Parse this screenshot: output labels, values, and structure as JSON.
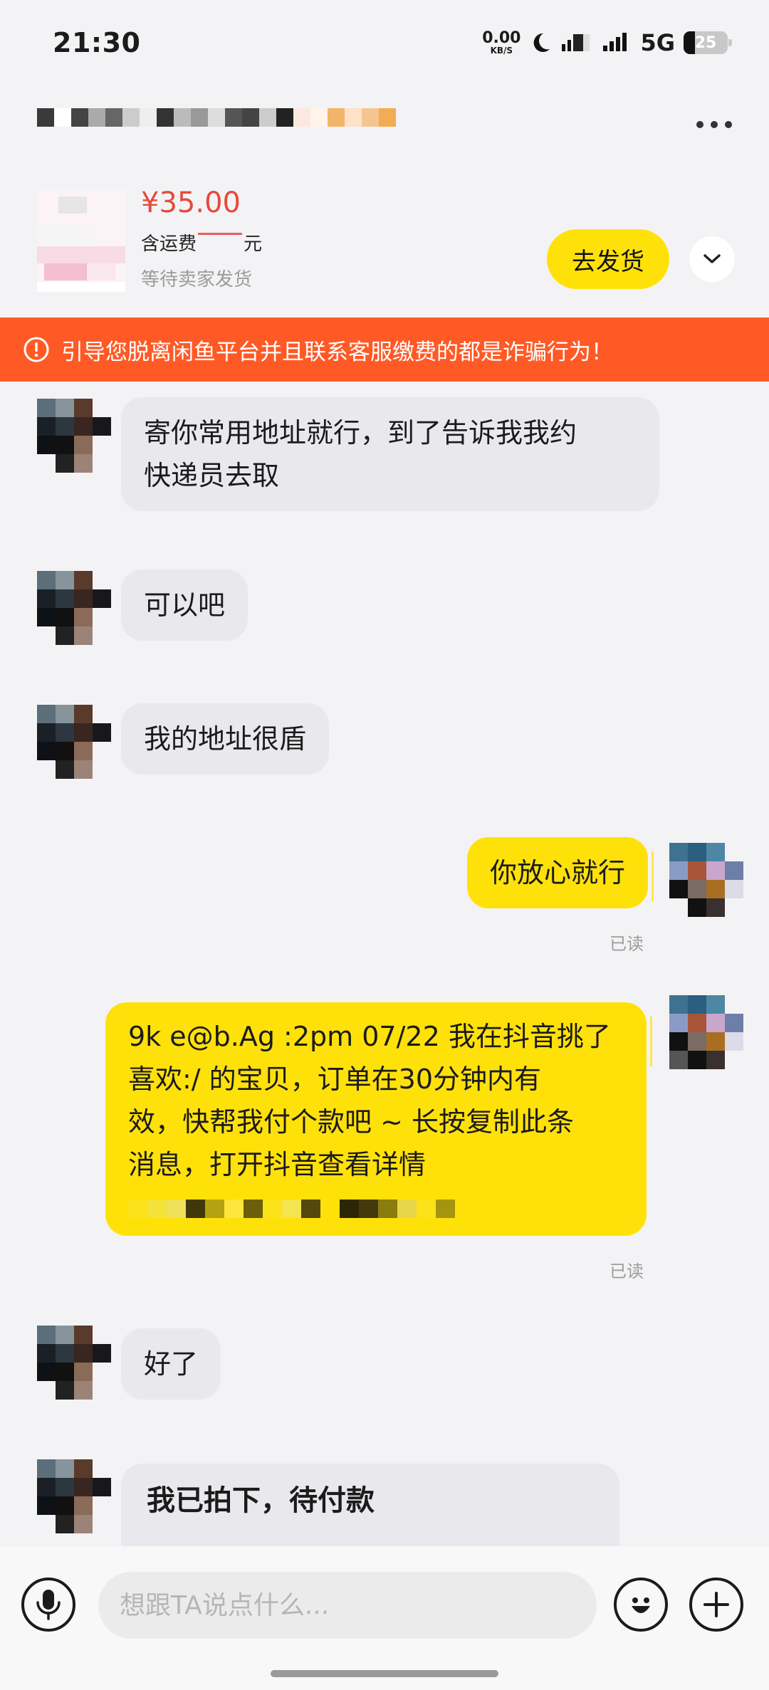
{
  "status_bar": {
    "time": "21:30",
    "net_speed_value": "0.00",
    "net_speed_unit": "KB/S",
    "network": "5G",
    "battery": "25"
  },
  "header": {
    "contact_name_hidden": true
  },
  "product": {
    "price": "¥35.00",
    "shipping_prefix": "含运费",
    "shipping_suffix": "元",
    "status": "等待卖家发货",
    "ship_button": "去发货"
  },
  "warning": {
    "text": "引导您脱离闲鱼平台并且联系客服缴费的都是诈骗行为！"
  },
  "messages": [
    {
      "side": "in",
      "text_lines": [
        "寄你常用地址就行，到了告诉我我约",
        "快递员去取"
      ]
    },
    {
      "side": "in",
      "text_lines": [
        "可以吧"
      ]
    },
    {
      "side": "in",
      "text_lines": [
        "我的地址很盾"
      ]
    },
    {
      "side": "out",
      "text_lines": [
        "你放心就行"
      ],
      "status": "已读"
    },
    {
      "side": "out",
      "text_lines": [
        "9k e@b.Ag :2pm 07/22 我在抖音挑了",
        "喜欢:/ 的宝贝，订单在30分钟内有",
        "效，快帮我付个款吧 ~ 长按复制此条",
        "消息，打开抖音查看详情"
      ],
      "status": "已读"
    },
    {
      "side": "in",
      "text_lines": [
        "好了"
      ]
    },
    {
      "side": "in",
      "card_title": "我已拍下，待付款"
    }
  ],
  "input": {
    "placeholder": "想跟TA说点什么..."
  },
  "icons": {
    "voice": "microphone-icon",
    "emoji": "emoji-icon",
    "plus": "plus-icon",
    "more": "more-dots-icon",
    "expand": "chevron-down-icon",
    "warning": "exclamation-circle-icon"
  },
  "colors": {
    "accent_yellow": "#ffe10a",
    "warning_orange": "#ff5a26",
    "price_red": "#e64a3b"
  }
}
